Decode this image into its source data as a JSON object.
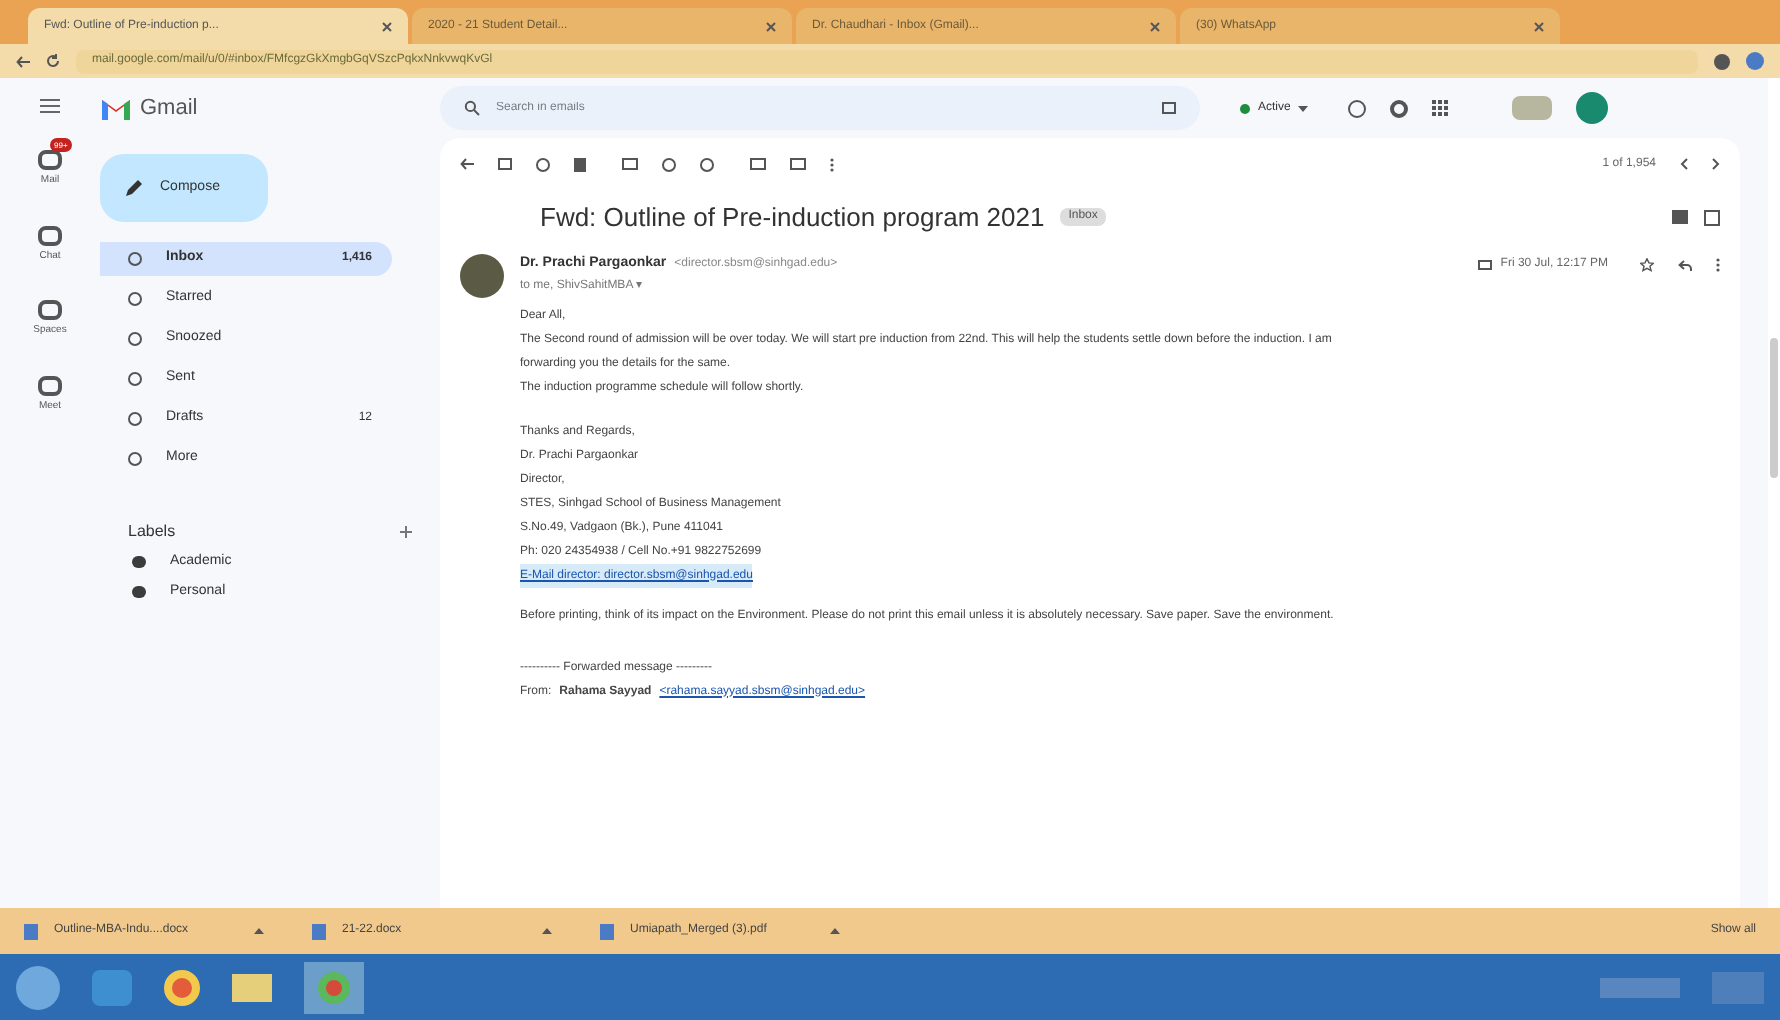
{
  "browser_tabs": [
    {
      "label": "Fwd: Outline of Pre-induction p...",
      "selected": true
    },
    {
      "label": "2020 - 21 Student Detail...",
      "selected": false
    },
    {
      "label": "Dr. Chaudhari - Inbox (Gmail)...",
      "selected": false
    },
    {
      "label": "(30) WhatsApp",
      "selected": false
    }
  ],
  "address": "mail.google.com/mail/u/0/#inbox/FMfcgzGkXmgbGqVSzcPqkxNnkvwqKvGl",
  "gmail": {
    "logo": "Gmail",
    "search": {
      "placeholder": "Search in emails"
    },
    "status": "Active"
  },
  "rail": [
    {
      "label": "Mail",
      "badge": "99+"
    },
    {
      "label": "Chat"
    },
    {
      "label": "Spaces"
    },
    {
      "label": "Meet"
    }
  ],
  "compose": "Compose",
  "folders": [
    {
      "label": "Inbox",
      "count": "1,416",
      "selected": true
    },
    {
      "label": "Starred",
      "selected": false
    },
    {
      "label": "Snoozed",
      "selected": false
    },
    {
      "label": "Sent",
      "selected": false
    },
    {
      "label": "Drafts",
      "count": "12",
      "selected": false
    },
    {
      "label": "More",
      "selected": false
    }
  ],
  "labels_heading": "Labels",
  "labels": [
    {
      "label": "Academic",
      "color": "#3c3c3c"
    },
    {
      "label": "Personal",
      "color": "#3c3c3c"
    }
  ],
  "pager": "1 of 1,954",
  "email": {
    "subject": "Fwd: Outline of Pre-induction program 2021",
    "tag": "Inbox",
    "sender": "Dr. Prachi Pargaonkar",
    "sender_email": "<director.sbsm@sinhgad.edu>",
    "to": "to me, ShivSahitMBA ▾",
    "date": "Fri 30 Jul, 12:17 PM",
    "body": [
      "Dear All,",
      "The Second round of admission will be over today. We will start pre induction from 22nd. This will help the students settle down before the induction. I am",
      "forwarding you the details for the same.",
      "The induction programme schedule will follow shortly."
    ],
    "signature": [
      "Thanks and Regards,",
      "Dr. Prachi Pargaonkar",
      "Director,",
      "STES, Sinhgad School of Business Management",
      "S.No.49, Vadgaon (Bk.), Pune 411041",
      "Ph: 020 24354938 / Cell No.+91 9822752699"
    ],
    "signature_link": "E-Mail director: director.sbsm@sinhgad.edu",
    "disclaimer": "Before printing, think of its impact on the Environment. Please do not print this email unless it is absolutely necessary. Save paper. Save the environment.",
    "forwarded": "---------- Forwarded message ---------",
    "from_label": "From:",
    "from_name": "Rahama Sayyad",
    "from_email": "<rahama.sayyad.sbsm@sinhgad.edu>"
  },
  "downloads": [
    {
      "label": "Outline-MBA-Indu....docx"
    },
    {
      "label": "21-22.docx"
    },
    {
      "label": "Umiapath_Merged (3).pdf"
    }
  ],
  "show_all": "Show all"
}
